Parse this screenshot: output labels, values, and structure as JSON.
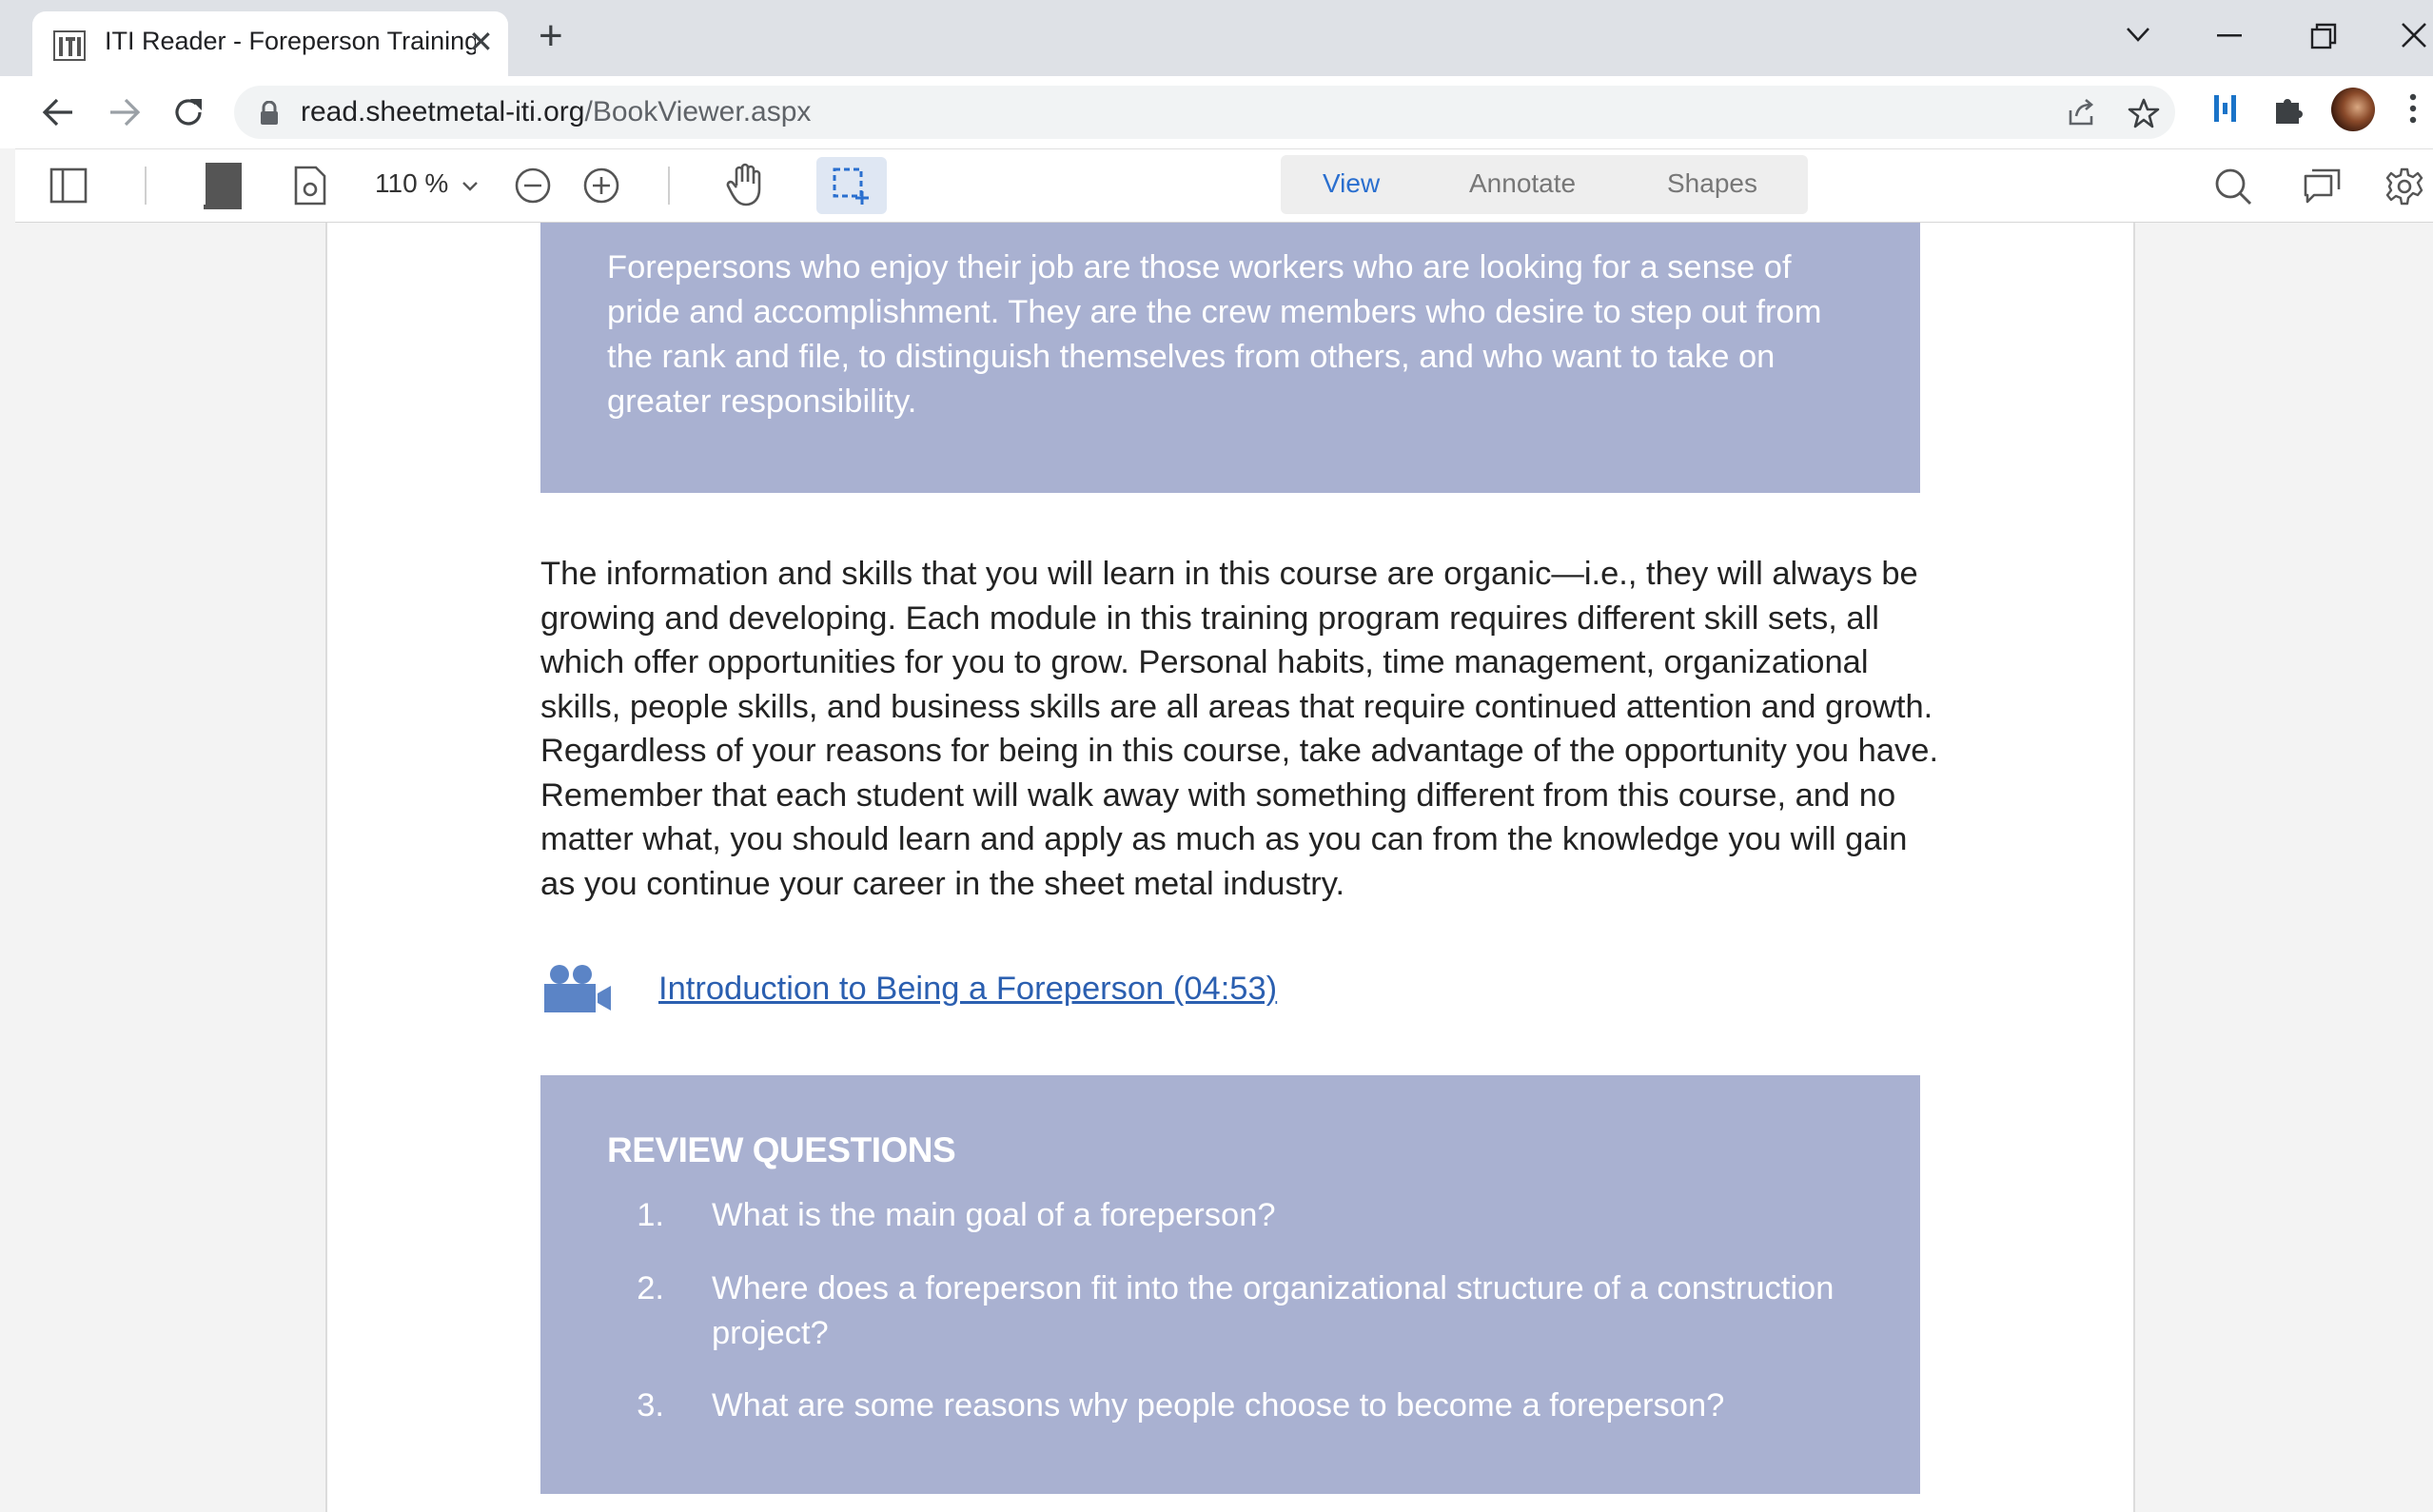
{
  "browser": {
    "tab_title": "ITI Reader - Foreperson Training",
    "tab_close": "✕",
    "new_tab": "+",
    "url_domain": "read.sheetmetal-iti.org",
    "url_path": "/BookViewer.aspx",
    "window_controls": {
      "dropdown": "⌄",
      "minimize": "—",
      "restore": "❐",
      "close": "✕"
    }
  },
  "reader_toolbar": {
    "zoom_level": "110 %",
    "modes": [
      {
        "label": "View",
        "active": true
      },
      {
        "label": "Annotate",
        "active": false
      },
      {
        "label": "Shapes",
        "active": false
      }
    ],
    "accent_color": "#2a6fcf"
  },
  "document": {
    "callout_text": "Forepersons who enjoy their job are those workers who are looking for a sense of pride and accomplishment. They are the crew members who desire to step out from the rank and file, to distinguish themselves from others, and who want to take on greater responsibility.",
    "body_paragraph": "The information and skills that you will learn in this course are organic—i.e., they will always be growing and developing. Each module in this training program requires different skill sets, all which offer opportunities for you to grow. Personal habits, time management, organizational skills, people skills, and business skills are all areas that require continued attention and growth. Regardless of your reasons for being in this course, take advantage of the opportunity you have. Remember that each student will walk away with something different from this course, and no matter what, you should learn and apply as much as you can from the knowledge you will gain as you continue your career in the sheet metal industry.",
    "video_link": "Introduction to Being a Foreperson (04:53)",
    "review": {
      "heading": "REVIEW QUESTIONS",
      "items": [
        {
          "num": "1.",
          "text": "What is the main goal of a foreperson?"
        },
        {
          "num": "2.",
          "text": "Where does a foreperson fit into the organizational structure of a construction project?"
        },
        {
          "num": "3.",
          "text": "What are some reasons why people choose to become a foreperson?"
        }
      ]
    },
    "box_color": "#a9b1d1"
  }
}
